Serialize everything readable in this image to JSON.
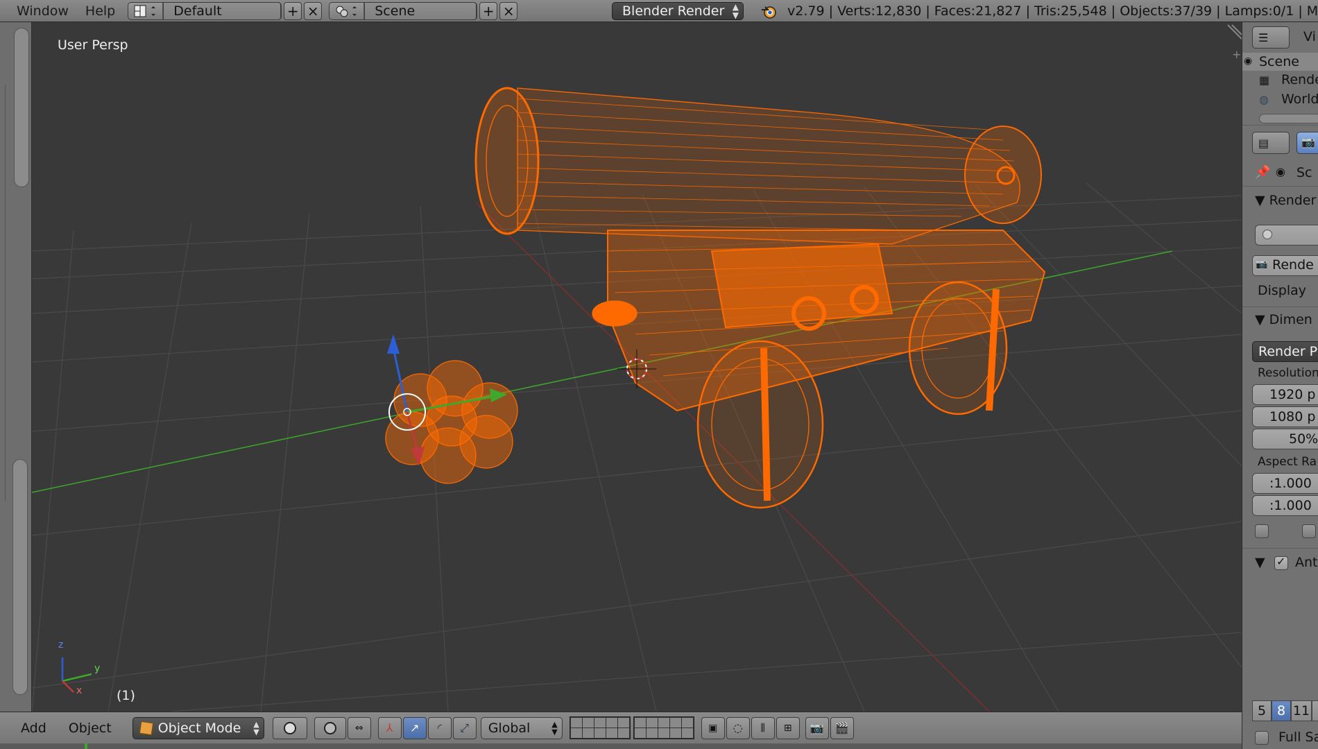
{
  "topbar": {
    "menus": [
      "Window",
      "Help"
    ],
    "layout": "Default",
    "scene": "Scene",
    "render_engine": "Blender Render",
    "stats": "v2.79 | Verts:12,830 | Faces:21,827 | Tris:25,548 | Objects:37/39 | Lamps:0/1 | Mem:3"
  },
  "viewport": {
    "view_label": "User Persp",
    "frame_label": "(1)",
    "axis_labels": {
      "z": "z",
      "y": "y",
      "x": "x"
    }
  },
  "bottombar": {
    "add": "Add",
    "object": "Object",
    "mode": "Object Mode",
    "orientation": "Global"
  },
  "right_panel": {
    "outliner": {
      "view": "Vi",
      "items": [
        "Scene",
        "Rende",
        "World"
      ]
    },
    "breadcrumb": "Sc",
    "render_section": "Render",
    "render_button": "Rende",
    "display_label": "Display",
    "dimensions_section": "Dimen",
    "render_presets": "Render Pr",
    "resolution_label": "Resolution",
    "res_x": "1920 p",
    "res_y": "1080 p",
    "res_pct": "50%",
    "aspect_label": "Aspect Ra",
    "aspect_x": ":1.000",
    "aspect_y": ":1.000",
    "aa_section": "Ant",
    "aa_samples": [
      "5",
      "8",
      "11",
      "1"
    ],
    "aa_selected": "8",
    "full_sample": "Full Sa"
  },
  "colors": {
    "selection_orange": "#ff6a00",
    "grid": "#4a4a4a",
    "x_axis": "#c03a3a",
    "y_axis": "#3ea82c",
    "z_axis": "#2c5fd6"
  }
}
